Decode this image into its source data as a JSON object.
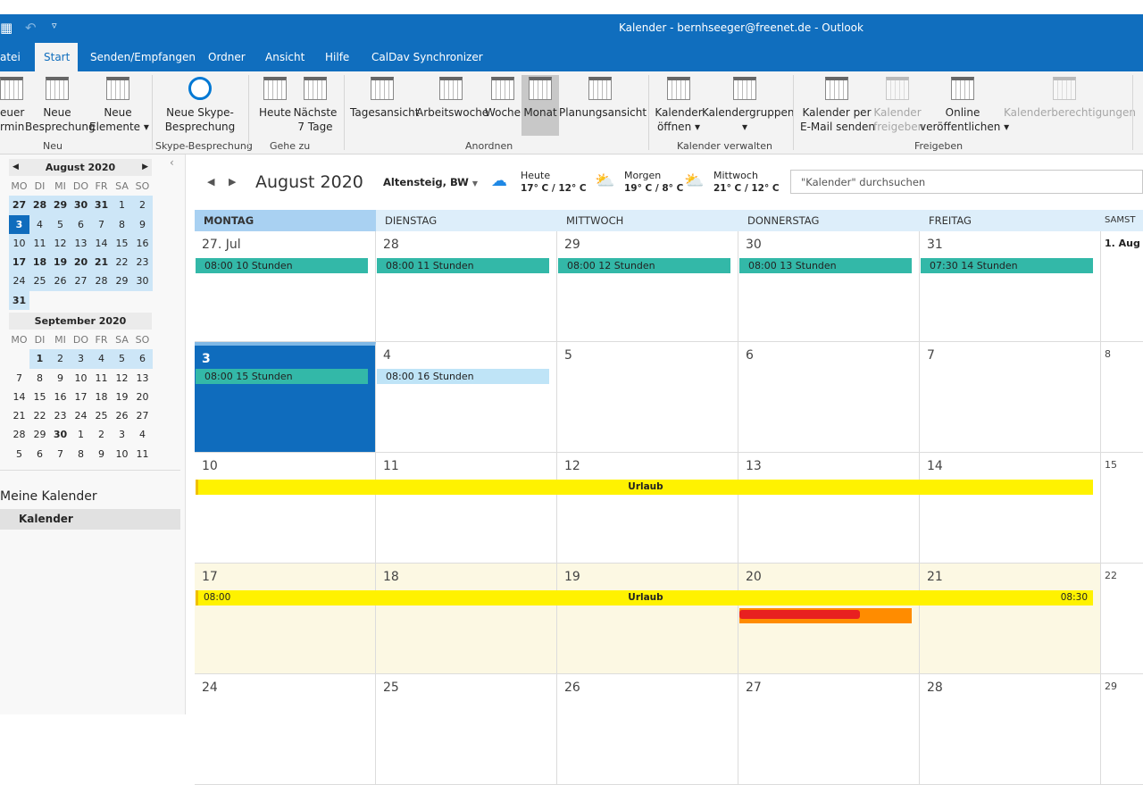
{
  "window": {
    "title": "Kalender - bernhseeger@freenet.de  -  Outlook"
  },
  "tabs": [
    "atei",
    "Start",
    "Senden/Empfangen",
    "Ordner",
    "Ansicht",
    "Hilfe",
    "CalDav Synchronizer"
  ],
  "ribbon": {
    "buttons": [
      {
        "l1": "euer",
        "l2": "rmin"
      },
      {
        "l1": "Neue",
        "l2": "Besprechung"
      },
      {
        "l1": "Neue",
        "l2": "Elemente ▾"
      },
      {
        "l1": "Neue Skype-",
        "l2": "Besprechung"
      },
      {
        "l1": "Heute",
        "l2": ""
      },
      {
        "l1": "Nächste",
        "l2": "7 Tage"
      },
      {
        "l1": "Tagesansicht",
        "l2": ""
      },
      {
        "l1": "Arbeitswoche",
        "l2": ""
      },
      {
        "l1": "Woche",
        "l2": ""
      },
      {
        "l1": "Monat",
        "l2": ""
      },
      {
        "l1": "Planungsansicht",
        "l2": ""
      },
      {
        "l1": "Kalender",
        "l2": "öffnen ▾"
      },
      {
        "l1": "Kalendergruppen",
        "l2": "▾"
      },
      {
        "l1": "Kalender per",
        "l2": "E-Mail senden"
      },
      {
        "l1": "Kalender",
        "l2": "freigeben"
      },
      {
        "l1": "Online",
        "l2": "veröffentlichen ▾"
      },
      {
        "l1": "Kalenderberechtigungen",
        "l2": ""
      }
    ],
    "groups": [
      "Neu",
      "Skype-Besprechung",
      "Gehe zu",
      "Anordnen",
      "Kalender verwalten",
      "Freigeben"
    ]
  },
  "sidebar": {
    "aug_title": "August 2020",
    "sep_title": "September 2020",
    "weekdays": [
      "MO",
      "DI",
      "MI",
      "DO",
      "FR",
      "SA",
      "SO"
    ],
    "aug": [
      [
        "27",
        "28",
        "29",
        "30",
        "31",
        "1",
        "2"
      ],
      [
        "3",
        "4",
        "5",
        "6",
        "7",
        "8",
        "9"
      ],
      [
        "10",
        "11",
        "12",
        "13",
        "14",
        "15",
        "16"
      ],
      [
        "17",
        "18",
        "19",
        "20",
        "21",
        "22",
        "23"
      ],
      [
        "24",
        "25",
        "26",
        "27",
        "28",
        "29",
        "30"
      ],
      [
        "31",
        "",
        "",
        "",
        "",
        "",
        ""
      ]
    ],
    "sep": [
      [
        "",
        "1",
        "2",
        "3",
        "4",
        "5",
        "6"
      ],
      [
        "7",
        "8",
        "9",
        "10",
        "11",
        "12",
        "13"
      ],
      [
        "14",
        "15",
        "16",
        "17",
        "18",
        "19",
        "20"
      ],
      [
        "21",
        "22",
        "23",
        "24",
        "25",
        "26",
        "27"
      ],
      [
        "28",
        "29",
        "30",
        "1",
        "2",
        "3",
        "4"
      ],
      [
        "5",
        "6",
        "7",
        "8",
        "9",
        "10",
        "11"
      ]
    ],
    "my_calendars": "Meine Kalender",
    "calendar_item": "Kalender"
  },
  "header": {
    "month": "August 2020",
    "location": "Altensteig, BW",
    "weather": [
      {
        "day": "Heute",
        "temp": "17° C / 12° C",
        "icon": "rain-cloud-icon"
      },
      {
        "day": "Morgen",
        "temp": "19° C / 8° C",
        "icon": "sun-cloud-icon"
      },
      {
        "day": "Mittwoch",
        "temp": "21° C / 12° C",
        "icon": "sun-cloud-icon"
      }
    ],
    "search_placeholder": "\"Kalender\" durchsuchen"
  },
  "calendar": {
    "days": [
      "MONTAG",
      "DIENSTAG",
      "MITTWOCH",
      "DONNERSTAG",
      "FREITAG",
      "SAMST"
    ],
    "weeks": [
      [
        "27. Jul",
        "28",
        "29",
        "30",
        "31",
        "1. Aug"
      ],
      [
        "3",
        "4",
        "5",
        "6",
        "7",
        "8"
      ],
      [
        "10",
        "11",
        "12",
        "13",
        "14",
        "15"
      ],
      [
        "17",
        "18",
        "19",
        "20",
        "21",
        "22"
      ],
      [
        "24",
        "25",
        "26",
        "27",
        "28",
        "29"
      ]
    ],
    "events": [
      {
        "week": 0,
        "col": 0,
        "span": 1,
        "text": "08:00 10 Stunden",
        "color": "#33b8a8"
      },
      {
        "week": 0,
        "col": 1,
        "span": 1,
        "text": "08:00 11 Stunden",
        "color": "#33b8a8"
      },
      {
        "week": 0,
        "col": 2,
        "span": 1,
        "text": "08:00 12 Stunden",
        "color": "#33b8a8"
      },
      {
        "week": 0,
        "col": 3,
        "span": 1,
        "text": "08:00 13 Stunden",
        "color": "#33b8a8"
      },
      {
        "week": 0,
        "col": 4,
        "span": 1,
        "text": "07:30 14 Stunden",
        "color": "#33b8a8"
      },
      {
        "week": 1,
        "col": 0,
        "span": 1,
        "text": "08:00 15 Stunden",
        "color": "#33b8a8"
      },
      {
        "week": 1,
        "col": 1,
        "span": 1,
        "text": "08:00 16 Stunden",
        "color": "#bfe4f7"
      },
      {
        "week": 2,
        "col": 0,
        "span": 5,
        "text": "Urlaub",
        "color": "#fff200"
      },
      {
        "week": 3,
        "col": 0,
        "span": 5,
        "text": "Urlaub",
        "start": "08:00",
        "end": "08:30",
        "color": "#fff200"
      }
    ],
    "colors": {
      "today": "#0f6cbd",
      "accent": "#106ebe",
      "vacation_bg": "#fcf8e3",
      "orange_event": "#ff8c00"
    }
  }
}
